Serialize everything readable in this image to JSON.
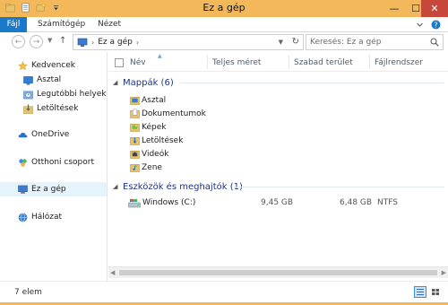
{
  "window": {
    "title": "Ez a gép",
    "minimize": "—",
    "maximize": "☐",
    "close": "✕"
  },
  "ribbon": {
    "tabs": [
      {
        "label": "Fájl"
      },
      {
        "label": "Számítógép"
      },
      {
        "label": "Nézet"
      }
    ],
    "help": "?"
  },
  "address": {
    "back": "←",
    "forward": "→",
    "up": "↑",
    "crumbs": [
      "Ez a gép"
    ],
    "search_placeholder": "Keresés: Ez a gép"
  },
  "navpane": {
    "items": [
      {
        "label": "Kedvencek",
        "icon": "star-icon"
      },
      {
        "label": "Asztal",
        "icon": "desktop-icon"
      },
      {
        "label": "Legutóbbi helyek",
        "icon": "recent-places-icon"
      },
      {
        "label": "Letöltések",
        "icon": "downloads-icon"
      },
      {
        "label": "OneDrive",
        "icon": "onedrive-icon"
      },
      {
        "label": "Otthoni csoport",
        "icon": "homegroup-icon"
      },
      {
        "label": "Ez a gép",
        "icon": "computer-icon"
      },
      {
        "label": "Hálózat",
        "icon": "network-icon"
      }
    ]
  },
  "columns": {
    "name": "Név",
    "total": "Teljes méret",
    "free": "Szabad terület",
    "fs": "Fájlrendszer"
  },
  "groups": {
    "folders": {
      "title": "Mappák (6)",
      "items": [
        {
          "label": "Asztal"
        },
        {
          "label": "Dokumentumok"
        },
        {
          "label": "Képek"
        },
        {
          "label": "Letöltések"
        },
        {
          "label": "Videók"
        },
        {
          "label": "Zene"
        }
      ]
    },
    "drives": {
      "title": "Eszközök és meghajtók (1)",
      "items": [
        {
          "label": "Windows (C:)",
          "total": "9,45 GB",
          "free": "6,48 GB",
          "fs": "NTFS"
        }
      ]
    }
  },
  "status": {
    "count": "7 elem"
  },
  "colors": {
    "titlebar": "#f3b85a",
    "file_tab": "#1979ca",
    "group_title": "#1e3287",
    "selection": "#e5f3fb"
  }
}
